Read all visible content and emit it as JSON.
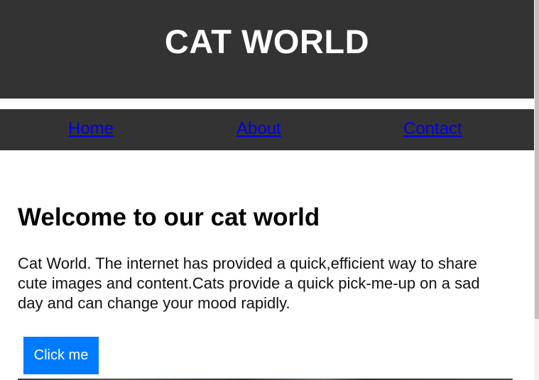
{
  "header": {
    "title": "CAT WORLD"
  },
  "nav": {
    "items": [
      {
        "label": "Home"
      },
      {
        "label": "About"
      },
      {
        "label": "Contact"
      }
    ]
  },
  "main": {
    "heading": "Welcome to our cat world",
    "paragraph": "Cat World. The internet has provided a quick,efficient way to share cute images and content.Cats provide a quick pick-me-up on a sad day and can change your mood rapidly.",
    "button_label": "Click me"
  },
  "colors": {
    "header_bg": "#333333",
    "nav_bg": "#333333",
    "link": "#0000ee",
    "button_bg": "#007bff",
    "button_text": "#ffffff"
  }
}
